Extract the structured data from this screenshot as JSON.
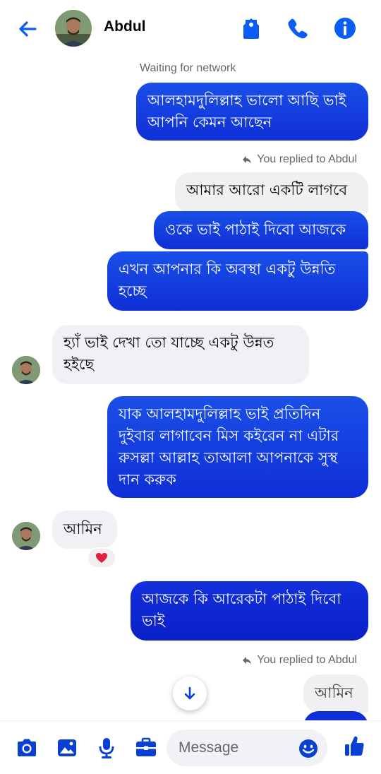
{
  "header": {
    "contact_name": "Abdul",
    "back_icon": "arrow-left-icon",
    "tag_icon": "tag-icon",
    "call_icon": "phone-icon",
    "info_icon": "info-icon"
  },
  "colors": {
    "accent": "#0a5cf5",
    "outgoing_bubble_top": "#1a4fe8",
    "outgoing_bubble_bottom": "#0f2fd6",
    "incoming_bubble": "#f0f0f5",
    "secondary_text": "#65676b"
  },
  "chat": {
    "status": "Waiting for network",
    "reply_notes": [
      "You replied to Abdul",
      "You replied to Abdul"
    ],
    "messages": [
      {
        "dir": "out",
        "text_lines": [
          "আলহামদুলিল্লাহ ভালো আছি ভাই",
          "আপনি কেমন আছেন"
        ]
      },
      {
        "dir": "quote",
        "text_lines": [
          "আমার আরো একটি লাগবে"
        ]
      },
      {
        "dir": "out",
        "text_lines": [
          "ওকে ভাই পাঠাই দিবো আজকে"
        ]
      },
      {
        "dir": "out",
        "text_lines": [
          "এখন আপনার কি অবস্থা একটু উন্নতি",
          "হচ্ছে"
        ]
      },
      {
        "dir": "in",
        "text_lines": [
          "হ্যাঁ ভাই দেখা তো যাচ্ছে একটু উন্নত",
          "হইছে"
        ]
      },
      {
        "dir": "out",
        "text_lines": [
          "যাক আলহামদুলিল্লাহ ভাই প্রতিদিন",
          "দুইবার লাগাবেন মিস কইরেন না এটার",
          "রুসল্লা আল্লাহ তাআলা আপনাকে সুস্থ",
          "দান করুক"
        ]
      },
      {
        "dir": "in",
        "text_lines": [
          "আমিন"
        ],
        "reaction": "❤️"
      },
      {
        "dir": "out",
        "text_lines": [
          "আজকে কি আরেকটা পাঠাই দিবো",
          "ভাই"
        ]
      },
      {
        "dir": "quote",
        "text_lines": [
          "আমিন"
        ]
      }
    ]
  },
  "composer": {
    "placeholder": "Message",
    "camera_icon": "camera-icon",
    "gallery_icon": "image-icon",
    "mic_icon": "microphone-icon",
    "briefcase_icon": "briefcase-icon",
    "emoji_icon": "smiley-icon",
    "like_icon": "thumbs-up-icon"
  }
}
